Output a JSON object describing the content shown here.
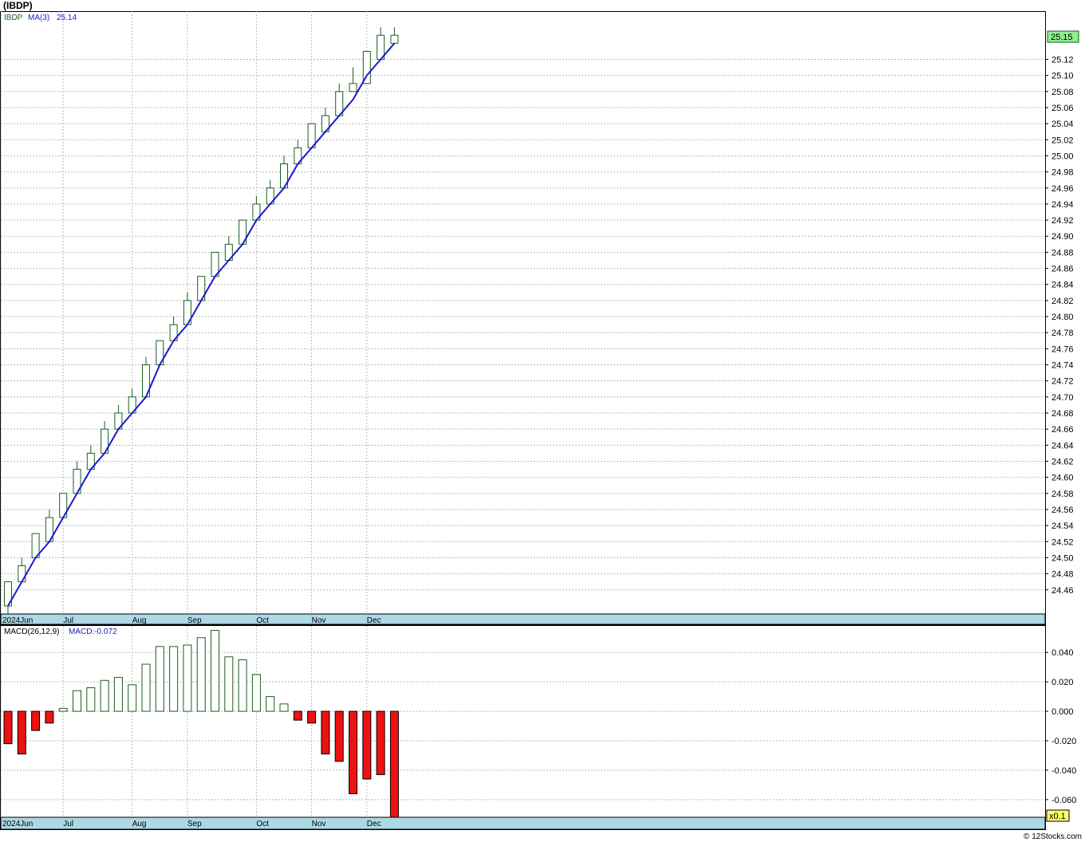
{
  "title": "(IBDP)",
  "credit": "© 12Stocks.com",
  "colors": {
    "up_candle": "#1b5e20",
    "ma_line": "#1a1acc",
    "macd_positive": "#1b5e20",
    "macd_negative": "#ee1111",
    "axis_band": "#add8e6",
    "last_price_badge": "#90ee90",
    "scale_badge": "#ffff66",
    "grid": "#b8b8b8"
  },
  "price_panel": {
    "legend_symbol": "IBDP",
    "legend_ma": "MA(3)",
    "legend_ma_value": "25.14",
    "last_price": "25.15"
  },
  "macd_panel": {
    "legend_label": "MACD(26,12,9)",
    "legend_value": "MACD:-0.072",
    "scale_label": "x0.1"
  },
  "chart_data": [
    {
      "type": "candlestick",
      "series_name": "IBDP",
      "ylim": [
        24.43,
        25.18
      ],
      "yticks": [
        24.46,
        24.48,
        24.5,
        24.52,
        24.54,
        24.56,
        24.58,
        24.6,
        24.62,
        24.64,
        24.66,
        24.68,
        24.7,
        24.72,
        24.74,
        24.76,
        24.78,
        24.8,
        24.82,
        24.84,
        24.86,
        24.88,
        24.9,
        24.92,
        24.94,
        24.96,
        24.98,
        25.0,
        25.02,
        25.04,
        25.06,
        25.08,
        25.1,
        25.12
      ],
      "x_labels": [
        {
          "text": "2024Jun",
          "index": -0.5
        },
        {
          "text": "Jul",
          "index": 4
        },
        {
          "text": "Aug",
          "index": 9
        },
        {
          "text": "Sep",
          "index": 13
        },
        {
          "text": "Oct",
          "index": 18
        },
        {
          "text": "Nov",
          "index": 22
        },
        {
          "text": "Dec",
          "index": 26
        }
      ],
      "candles": [
        {
          "o": 24.44,
          "h": 24.47,
          "l": 24.43,
          "c": 24.47
        },
        {
          "o": 24.47,
          "h": 24.5,
          "l": 24.47,
          "c": 24.49
        },
        {
          "o": 24.5,
          "h": 24.53,
          "l": 24.5,
          "c": 24.53
        },
        {
          "o": 24.52,
          "h": 24.56,
          "l": 24.52,
          "c": 24.55
        },
        {
          "o": 24.55,
          "h": 24.58,
          "l": 24.55,
          "c": 24.58
        },
        {
          "o": 24.58,
          "h": 24.62,
          "l": 24.58,
          "c": 24.61
        },
        {
          "o": 24.61,
          "h": 24.64,
          "l": 24.61,
          "c": 24.63
        },
        {
          "o": 24.63,
          "h": 24.67,
          "l": 24.63,
          "c": 24.66
        },
        {
          "o": 24.66,
          "h": 24.69,
          "l": 24.66,
          "c": 24.68
        },
        {
          "o": 24.68,
          "h": 24.71,
          "l": 24.68,
          "c": 24.7
        },
        {
          "o": 24.7,
          "h": 24.75,
          "l": 24.7,
          "c": 24.74
        },
        {
          "o": 24.74,
          "h": 24.77,
          "l": 24.74,
          "c": 24.77
        },
        {
          "o": 24.77,
          "h": 24.8,
          "l": 24.77,
          "c": 24.79
        },
        {
          "o": 24.79,
          "h": 24.83,
          "l": 24.79,
          "c": 24.82
        },
        {
          "o": 24.82,
          "h": 24.85,
          "l": 24.82,
          "c": 24.85
        },
        {
          "o": 24.85,
          "h": 24.88,
          "l": 24.85,
          "c": 24.88
        },
        {
          "o": 24.87,
          "h": 24.9,
          "l": 24.87,
          "c": 24.89
        },
        {
          "o": 24.89,
          "h": 24.92,
          "l": 24.89,
          "c": 24.92
        },
        {
          "o": 24.92,
          "h": 24.95,
          "l": 24.92,
          "c": 24.94
        },
        {
          "o": 24.94,
          "h": 24.97,
          "l": 24.94,
          "c": 24.96
        },
        {
          "o": 24.96,
          "h": 25.0,
          "l": 24.96,
          "c": 24.99
        },
        {
          "o": 24.99,
          "h": 25.02,
          "l": 24.99,
          "c": 25.01
        },
        {
          "o": 25.01,
          "h": 25.04,
          "l": 25.01,
          "c": 25.04
        },
        {
          "o": 25.03,
          "h": 25.06,
          "l": 25.03,
          "c": 25.05
        },
        {
          "o": 25.05,
          "h": 25.09,
          "l": 25.05,
          "c": 25.08
        },
        {
          "o": 25.08,
          "h": 25.11,
          "l": 25.08,
          "c": 25.09
        },
        {
          "o": 25.09,
          "h": 25.13,
          "l": 25.09,
          "c": 25.13
        },
        {
          "o": 25.12,
          "h": 25.16,
          "l": 25.12,
          "c": 25.15
        },
        {
          "o": 25.14,
          "h": 25.16,
          "l": 25.14,
          "c": 25.15
        }
      ],
      "ma": [
        24.44,
        24.47,
        24.5,
        24.52,
        24.55,
        24.58,
        24.61,
        24.63,
        24.66,
        24.68,
        24.7,
        24.74,
        24.77,
        24.79,
        24.82,
        24.85,
        24.87,
        24.89,
        24.92,
        24.94,
        24.96,
        24.99,
        25.01,
        25.03,
        25.05,
        25.07,
        25.1,
        25.12,
        25.14
      ]
    },
    {
      "type": "bar",
      "series_name": "MACD",
      "ylim": [
        -0.072,
        0.058
      ],
      "yticks": [
        0.04,
        0.02,
        0.0,
        -0.02,
        -0.04,
        -0.06
      ],
      "ytick_labels": [
        "0.040",
        "0.020",
        "0.000",
        "-0.020",
        "-0.040",
        "-0.060"
      ],
      "x_labels": [
        {
          "text": "2024Jun",
          "index": -0.5
        },
        {
          "text": "Jul",
          "index": 4
        },
        {
          "text": "Aug",
          "index": 9
        },
        {
          "text": "Sep",
          "index": 13
        },
        {
          "text": "Oct",
          "index": 18
        },
        {
          "text": "Nov",
          "index": 22
        },
        {
          "text": "Dec",
          "index": 26
        }
      ],
      "values": [
        -0.022,
        -0.029,
        -0.013,
        -0.008,
        0.002,
        0.014,
        0.016,
        0.021,
        0.023,
        0.018,
        0.032,
        0.044,
        0.044,
        0.045,
        0.05,
        0.055,
        0.037,
        0.035,
        0.025,
        0.01,
        0.005,
        -0.006,
        -0.008,
        -0.029,
        -0.034,
        -0.056,
        -0.046,
        -0.043,
        -0.072
      ]
    }
  ]
}
